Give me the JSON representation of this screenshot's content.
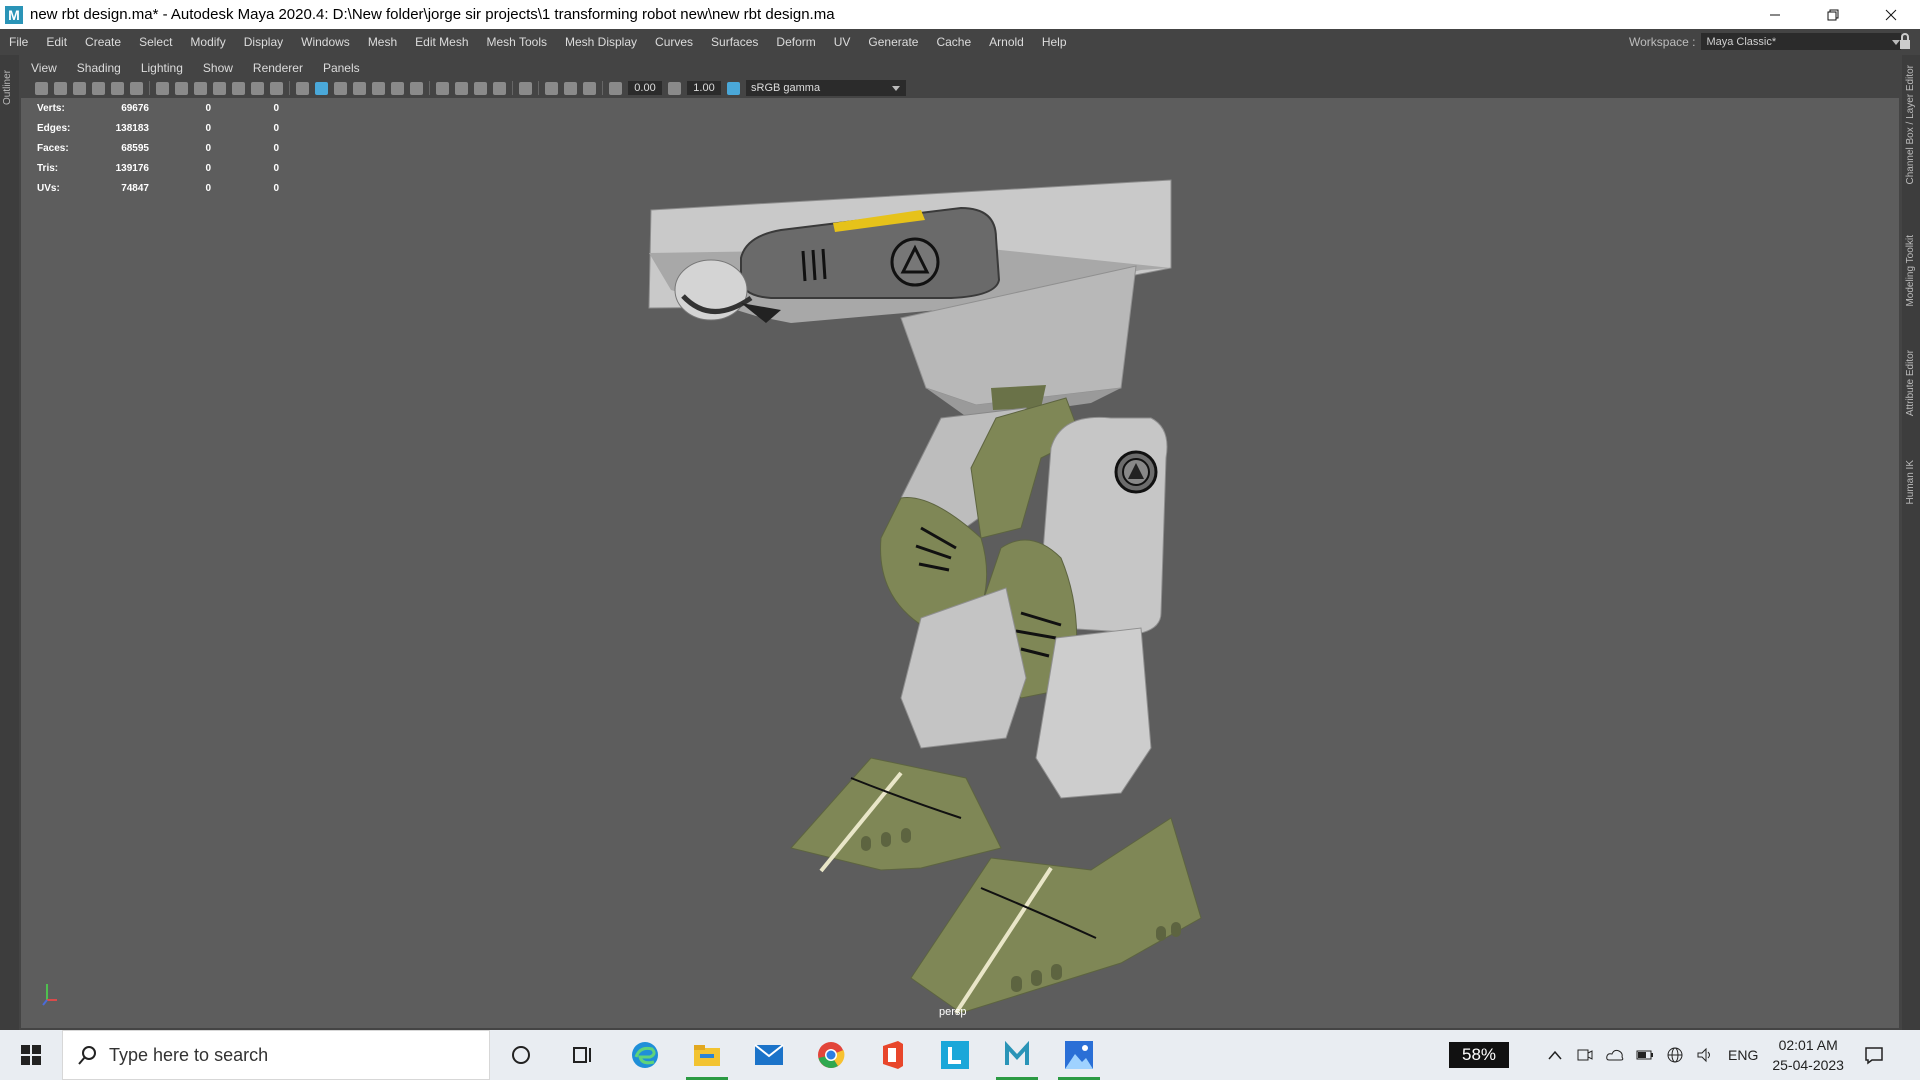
{
  "window": {
    "app_icon_letter": "M",
    "title": "new rbt design.ma* - Autodesk Maya 2020.4: D:\\New folder\\jorge sir projects\\1 transforming robot new\\new rbt design.ma",
    "controls": [
      "minimize-icon",
      "restore-icon",
      "close-icon"
    ]
  },
  "menubar": {
    "items": [
      "File",
      "Edit",
      "Create",
      "Select",
      "Modify",
      "Display",
      "Windows",
      "Mesh",
      "Edit Mesh",
      "Mesh Tools",
      "Mesh Display",
      "Curves",
      "Surfaces",
      "Deform",
      "UV",
      "Generate",
      "Cache",
      "Arnold",
      "Help"
    ],
    "workspace_label": "Workspace :",
    "workspace_value": "Maya Classic*"
  },
  "left_panel": {
    "label": "Outliner"
  },
  "right_tabs": [
    "Channel Box / Layer Editor",
    "Modeling Toolkit",
    "Attribute Editor",
    "Human IK"
  ],
  "viewport": {
    "panel_menu": [
      "View",
      "Shading",
      "Lighting",
      "Show",
      "Renderer",
      "Panels"
    ],
    "exposure": "0.00",
    "gamma": "1.00",
    "color_space": "sRGB gamma",
    "camera": "persp",
    "hud": [
      {
        "label": "Verts:",
        "v1": "69676",
        "v2": "0",
        "v3": "0"
      },
      {
        "label": "Edges:",
        "v1": "138183",
        "v2": "0",
        "v3": "0"
      },
      {
        "label": "Faces:",
        "v1": "68595",
        "v2": "0",
        "v3": "0"
      },
      {
        "label": "Tris:",
        "v1": "139176",
        "v2": "0",
        "v3": "0"
      },
      {
        "label": "UVs:",
        "v1": "74847",
        "v2": "0",
        "v3": "0"
      }
    ]
  },
  "taskbar": {
    "search_placeholder": "Type here to search",
    "pinned": [
      "cortana-icon",
      "task-view-icon",
      "edge-icon",
      "file-explorer-icon",
      "mail-icon",
      "chrome-icon",
      "office-icon",
      "l-app-icon",
      "maya-icon",
      "photos-icon"
    ],
    "battery": "58%",
    "language": "ENG",
    "time": "02:01 AM",
    "date": "25-04-2023"
  },
  "colors": {
    "viewport_bg": "#5d5d5d",
    "model_grey": "#c4c4c4",
    "model_green": "#7f8756",
    "accent_yellow": "#e6c21a",
    "ui_dark": "#444444"
  }
}
